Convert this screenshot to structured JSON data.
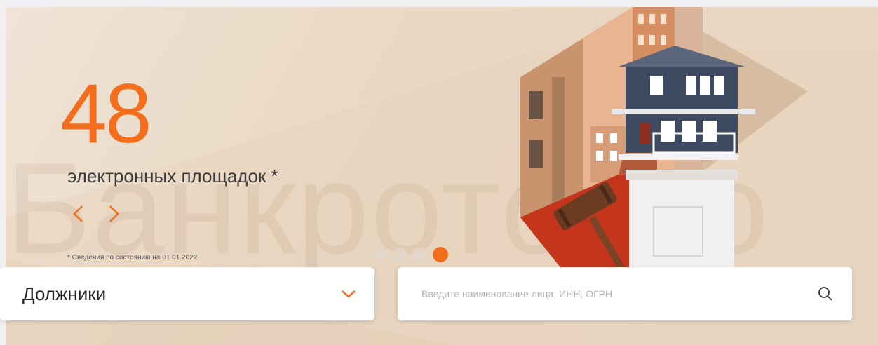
{
  "hero": {
    "number": "48",
    "subtitle": "электронных площадок *",
    "note": "* Сведения по состоянию на 01.01.2022",
    "watermark": "Банкротство",
    "accent_color": "#f26e1d",
    "slides_total": 4,
    "active_slide": 4
  },
  "filters": {
    "category_select": {
      "selected": "Должники"
    },
    "search": {
      "placeholder": "Введите наименование лица, ИНН, ОГРН",
      "value": ""
    }
  },
  "icons": {
    "prev": "chevron-left-icon",
    "next": "chevron-right-icon",
    "dropdown": "chevron-down-icon",
    "search": "search-icon"
  }
}
